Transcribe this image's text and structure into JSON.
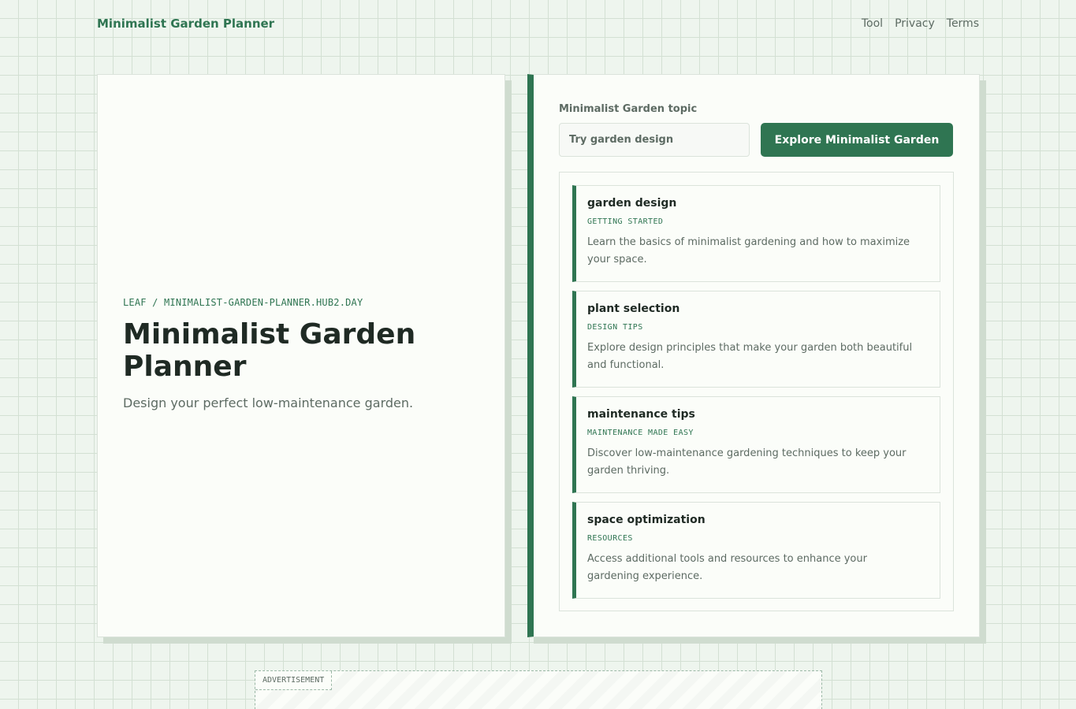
{
  "header": {
    "brand": "Minimalist Garden Planner",
    "nav": [
      "Tool",
      "Privacy",
      "Terms"
    ]
  },
  "intro": {
    "breadcrumb": "LEAF / MINIMALIST-GARDEN-PLANNER.HUB2.DAY",
    "title": "Minimalist Garden Planner",
    "subtitle": "Design your perfect low-maintenance garden."
  },
  "tool": {
    "topic_label": "Minimalist Garden topic",
    "search_placeholder": "Try garden design",
    "search_value": "",
    "explore_label": "Explore Minimalist Garden"
  },
  "results": [
    {
      "title": "garden design",
      "tag": "GETTING STARTED",
      "desc": "Learn the basics of minimalist gardening and how to maximize your space."
    },
    {
      "title": "plant selection",
      "tag": "DESIGN TIPS",
      "desc": "Explore design principles that make your garden both beautiful and functional."
    },
    {
      "title": "maintenance tips",
      "tag": "MAINTENANCE MADE EASY",
      "desc": "Discover low-maintenance gardening techniques to keep your garden thriving."
    },
    {
      "title": "space optimization",
      "tag": "RESOURCES",
      "desc": "Access additional tools and resources to enhance your gardening experience."
    }
  ],
  "ad": {
    "label": "ADVERTISEMENT"
  },
  "colors": {
    "accent": "#2f7552",
    "background": "#eef5ee",
    "panel": "#fbfdf9",
    "muted_text": "#5d6b63"
  }
}
